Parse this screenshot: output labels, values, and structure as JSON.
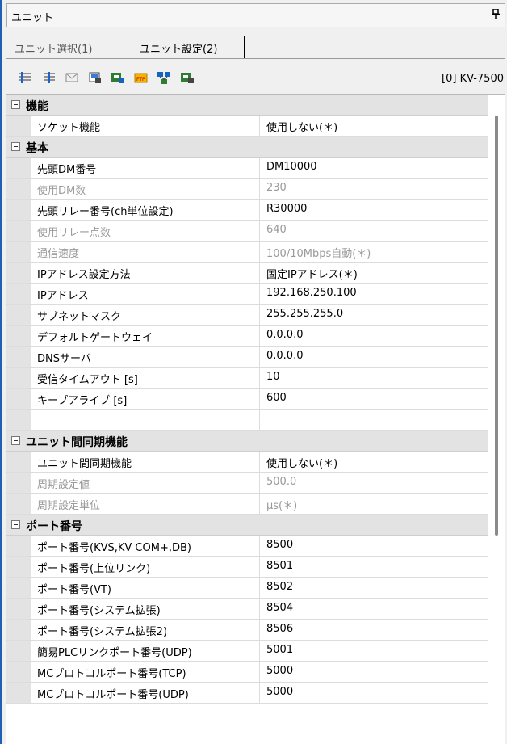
{
  "panel": {
    "title": "ユニット",
    "pin_glyph": "ᵖ"
  },
  "tabs": [
    {
      "label": "ユニット選択(1)"
    },
    {
      "label": "ユニット設定(2)"
    }
  ],
  "toolbar": {
    "icons": [
      "sort-icon",
      "sort-asc-icon",
      "mail-icon",
      "unit-icon",
      "unit-settings-icon",
      "ftp-icon",
      "network-icon",
      "download-icon"
    ],
    "device": "[0] KV-7500"
  },
  "grid": {
    "categories": [
      {
        "label": "機能",
        "rows": [
          {
            "name": "ソケット機能",
            "value": "使用しない(＊)"
          }
        ]
      },
      {
        "label": "基本",
        "rows": [
          {
            "name": "先頭DM番号",
            "value": "DM10000"
          },
          {
            "name": "使用DM数",
            "value": "230"
          },
          {
            "name": "先頭リレー番号(ch単位設定)",
            "value": "R30000"
          },
          {
            "name": "使用リレー点数",
            "value": "640"
          },
          {
            "name": "通信速度",
            "value": "100/10Mbps自動(＊)"
          },
          {
            "name": "IPアドレス設定方法",
            "value": "固定IPアドレス(＊)"
          },
          {
            "name": "IPアドレス",
            "value": "192.168.250.100"
          },
          {
            "name": "サブネットマスク",
            "value": "255.255.255.0"
          },
          {
            "name": "デフォルトゲートウェイ",
            "value": "0.0.0.0"
          },
          {
            "name": "DNSサーバ",
            "value": "0.0.0.0"
          },
          {
            "name": "受信タイムアウト [s]",
            "value": "10"
          },
          {
            "name": "キープアライブ [s]",
            "value": "600"
          }
        ]
      },
      {
        "label": "ユニット間同期機能",
        "rows": [
          {
            "name": "ユニット間同期機能",
            "value": "使用しない(＊)"
          },
          {
            "name": "周期設定値",
            "value": "500.0"
          },
          {
            "name": "周期設定単位",
            "value": "µs(＊)"
          }
        ]
      },
      {
        "label": "ポート番号",
        "rows": [
          {
            "name": "ポート番号(KVS,KV COM+,DB)",
            "value": "8500"
          },
          {
            "name": "ポート番号(上位リンク)",
            "value": "8501"
          },
          {
            "name": "ポート番号(VT)",
            "value": "8502"
          },
          {
            "name": "ポート番号(システム拡張)",
            "value": "8504"
          },
          {
            "name": "ポート番号(システム拡張2)",
            "value": "8506"
          },
          {
            "name": "簡易PLCリンクポート番号(UDP)",
            "value": "5001"
          },
          {
            "name": "MCプロトコルポート番号(TCP)",
            "value": "5000"
          },
          {
            "name": "MCプロトコルポート番号(UDP)",
            "value": "5000"
          }
        ]
      }
    ]
  }
}
